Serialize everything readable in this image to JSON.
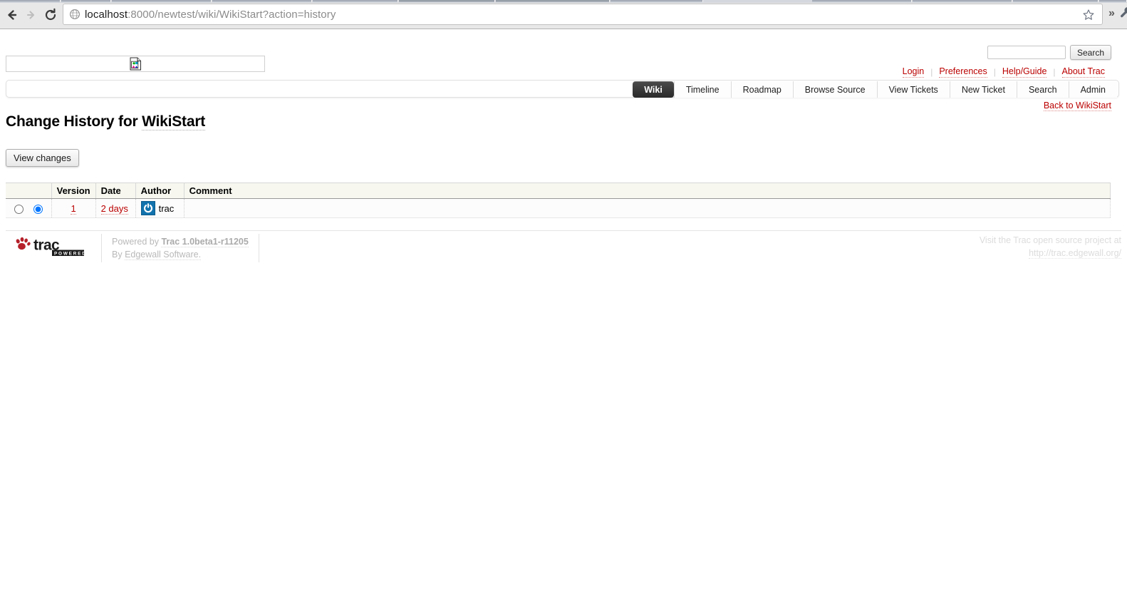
{
  "browser": {
    "back_icon": "arrow-left-icon",
    "forward_icon": "arrow-right-icon",
    "reload_icon": "reload-icon",
    "url_host": "localhost",
    "url_rest": ":8000/newtest/wiki/WikiStart?action=history",
    "url_full": "localhost:8000/newtest/wiki/WikiStart?action=history",
    "site_icon": "globe-icon",
    "bookmark_icon": "star-icon",
    "more_label": "»",
    "wrench_icon": "wrench-icon"
  },
  "header": {
    "logo_alt": "broken-image-placeholder",
    "search": {
      "value": "",
      "placeholder": "",
      "button_label": "Search"
    },
    "metanav": [
      {
        "label": "Login"
      },
      {
        "label": "Preferences"
      },
      {
        "label": "Help/Guide"
      },
      {
        "label": "About Trac"
      }
    ]
  },
  "mainnav": [
    {
      "label": "Wiki",
      "active": true
    },
    {
      "label": "Timeline",
      "active": false
    },
    {
      "label": "Roadmap",
      "active": false
    },
    {
      "label": "Browse Source",
      "active": false
    },
    {
      "label": "View Tickets",
      "active": false
    },
    {
      "label": "New Ticket",
      "active": false
    },
    {
      "label": "Search",
      "active": false
    },
    {
      "label": "Admin",
      "active": false
    }
  ],
  "ctxtnav": {
    "back_label": "Back to WikiStart"
  },
  "main": {
    "title_prefix": "Change History for ",
    "title_page": "WikiStart",
    "view_changes_label": "View changes",
    "table": {
      "headers": [
        "",
        "Version",
        "Date",
        "Author",
        "Comment"
      ],
      "rows": [
        {
          "old_selected": false,
          "new_selected": true,
          "version": "1",
          "date": "2 days",
          "author": "trac",
          "author_avatar": "power-symbol-avatar",
          "comment": ""
        }
      ]
    }
  },
  "footer": {
    "logo_text": "trac",
    "logo_sub": "POWERED",
    "powered_by_prefix": "Powered by ",
    "powered_by_product": "Trac 1.0beta1-r11205",
    "by_prefix": "By ",
    "by_company": "Edgewall Software.",
    "visit_line1": "Visit the Trac open source project at",
    "visit_url": "http://trac.edgewall.org/"
  },
  "colors": {
    "link_red": "#b00",
    "active_tab_bg": "#2a2a2a",
    "table_header_bg": "#f7f7f0",
    "avatar_blue": "#1273ad",
    "paw_red": "#b5202a"
  }
}
